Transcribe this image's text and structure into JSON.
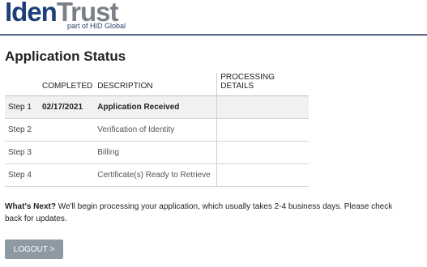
{
  "header": {
    "logo_iden": "Iden",
    "logo_trust": "Trust",
    "tagline": "part of HID Global"
  },
  "page_title": "Application Status",
  "table": {
    "columns": [
      "",
      "COMPLETED",
      "DESCRIPTION",
      "PROCESSING DETAILS"
    ],
    "rows": [
      {
        "step": "Step 1",
        "completed": "02/17/2021",
        "description": "Application Received",
        "details": "",
        "active": true
      },
      {
        "step": "Step 2",
        "completed": "",
        "description": "Verification of Identity",
        "details": "",
        "active": false
      },
      {
        "step": "Step 3",
        "completed": "",
        "description": "Billing",
        "details": "",
        "active": false
      },
      {
        "step": "Step 4",
        "completed": "",
        "description": "Certificate(s) Ready to Retrieve",
        "details": "",
        "active": false
      }
    ]
  },
  "next": {
    "label": "What's Next?",
    "text": " We'll begin processing your application, which usually takes 2-4 business days. Please check back for updates."
  },
  "logout_label": "LOGOUT >",
  "colors": {
    "brand_blue": "#1d3f7a",
    "brand_gray": "#7b7f86",
    "button_gray": "#8e9aa3"
  }
}
